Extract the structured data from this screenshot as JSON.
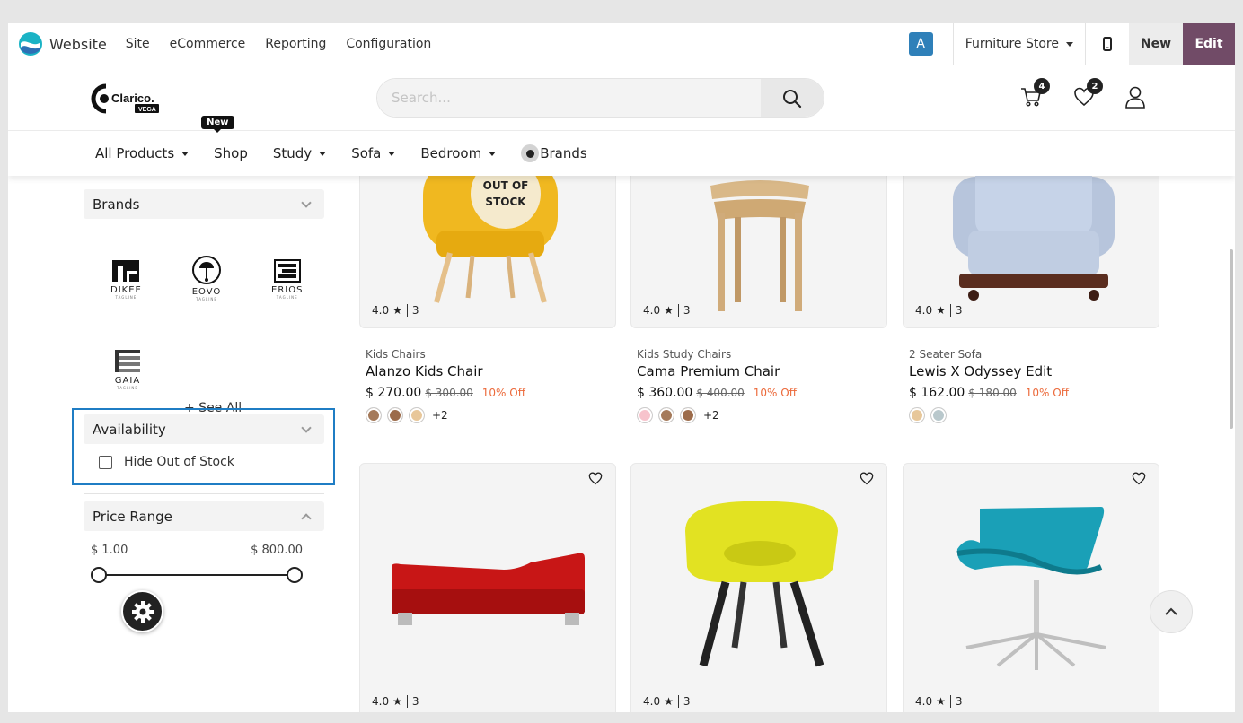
{
  "odoo_bar": {
    "app_title": "Website",
    "menu": [
      "Site",
      "eCommerce",
      "Reporting",
      "Configuration"
    ],
    "avatar_letter": "A",
    "website_name": "Furniture Store",
    "new_label": "New",
    "edit_label": "Edit",
    "edit_color": "#714b67"
  },
  "header": {
    "logo_text": "Clarico.",
    "logo_sub": "VEGA",
    "search_placeholder": "Search...",
    "cart_count": "4",
    "wishlist_count": "2"
  },
  "nav": {
    "items": [
      {
        "label": "All Products",
        "dropdown": true
      },
      {
        "label": "Shop",
        "dropdown": false,
        "tag": "New"
      },
      {
        "label": "Study",
        "dropdown": true
      },
      {
        "label": "Sofa",
        "dropdown": true
      },
      {
        "label": "Bedroom",
        "dropdown": true
      },
      {
        "label": "Brands",
        "dropdown": false
      }
    ]
  },
  "sidebar": {
    "brands_title": "Brands",
    "brands": [
      {
        "name": "DIKEE",
        "tagline": "TAGLINE"
      },
      {
        "name": "EOVO",
        "tagline": "TAGLINE"
      },
      {
        "name": "ERIOS",
        "tagline": "TAGLINE"
      },
      {
        "name": "GAIA",
        "tagline": "TAGLINE"
      }
    ],
    "see_all": "+ See All",
    "availability_title": "Availability",
    "hide_out_of_stock": "Hide Out of Stock",
    "price_title": "Price Range",
    "price_min": "$ 1.00",
    "price_max": "$ 800.00"
  },
  "products": [
    {
      "category": "Kids Chairs",
      "name": "Alanzo Kids Chair",
      "price": "$ 270.00",
      "old_price": "$ 300.00",
      "off": "10% Off",
      "rating": "4.0",
      "reviews": "3",
      "swatches": [
        "#a57a5a",
        "#9c6b4a",
        "#e8c79a"
      ],
      "more": "+2",
      "out_of_stock": "OUT OF STOCK"
    },
    {
      "category": "Kids Study Chairs",
      "name": "Cama Premium Chair",
      "price": "$ 360.00",
      "old_price": "$ 400.00",
      "off": "10% Off",
      "rating": "4.0",
      "reviews": "3",
      "swatches": [
        "#f7c3cc",
        "#a57a5a",
        "#9c6b4a"
      ],
      "more": "+2"
    },
    {
      "category": "2 Seater Sofa",
      "name": "Lewis X Odyssey Edit",
      "price": "$ 162.00",
      "old_price": "$ 180.00",
      "off": "10% Off",
      "rating": "4.0",
      "reviews": "3",
      "swatches": [
        "#e7c79a",
        "#b9c8cc"
      ],
      "more": ""
    },
    {
      "rating": "4.0",
      "reviews": "3"
    },
    {
      "rating": "4.0",
      "reviews": "3"
    },
    {
      "rating": "4.0",
      "reviews": "3"
    }
  ]
}
